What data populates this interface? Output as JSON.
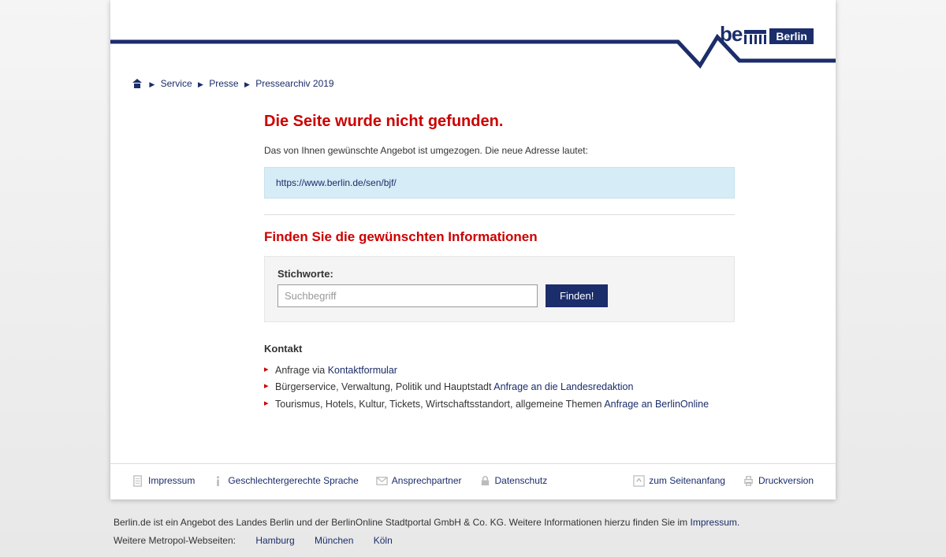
{
  "logo": {
    "be": "be",
    "berlin": "Berlin"
  },
  "breadcrumb": {
    "items": [
      "Service",
      "Presse",
      "Pressearchiv 2019"
    ]
  },
  "main": {
    "heading": "Die Seite wurde nicht gefunden.",
    "intro": "Das von Ihnen gewünschte Angebot ist umgezogen. Die neue Adresse lautet:",
    "url": "https://www.berlin.de/sen/bjf/",
    "find_heading": "Finden Sie die gewünschten Informationen",
    "search": {
      "label": "Stichworte:",
      "placeholder": "Suchbegriff",
      "button": "Finden!"
    },
    "contact": {
      "heading": "Kontakt",
      "items": [
        {
          "prefix": "Anfrage via ",
          "link": "Kontaktformular",
          "suffix": ""
        },
        {
          "prefix": "Bürgerservice, Verwaltung, Politik und Hauptstadt ",
          "link": "Anfrage an die Landesredaktion",
          "suffix": ""
        },
        {
          "prefix": "Tourismus, Hotels, Kultur, Tickets, Wirtschaftsstandort, allgemeine Themen ",
          "link": "Anfrage an BerlinOnline",
          "suffix": ""
        }
      ]
    }
  },
  "footer": {
    "left": [
      "Impressum",
      "Geschlechtergerechte Sprache",
      "Ansprechpartner",
      "Datenschutz"
    ],
    "right": [
      "zum Seitenanfang",
      "Druckversion"
    ]
  },
  "subfooter": {
    "line1_a": "Berlin.de ist ein Angebot des Landes Berlin und der BerlinOnline Stadtportal GmbH & Co. KG. Weitere Informationen hierzu finden Sie im ",
    "line1_link": "Impressum",
    "line1_b": ".",
    "line2_label": "Weitere Metropol-Webseiten:",
    "metros": [
      "Hamburg",
      "München",
      "Köln"
    ]
  }
}
